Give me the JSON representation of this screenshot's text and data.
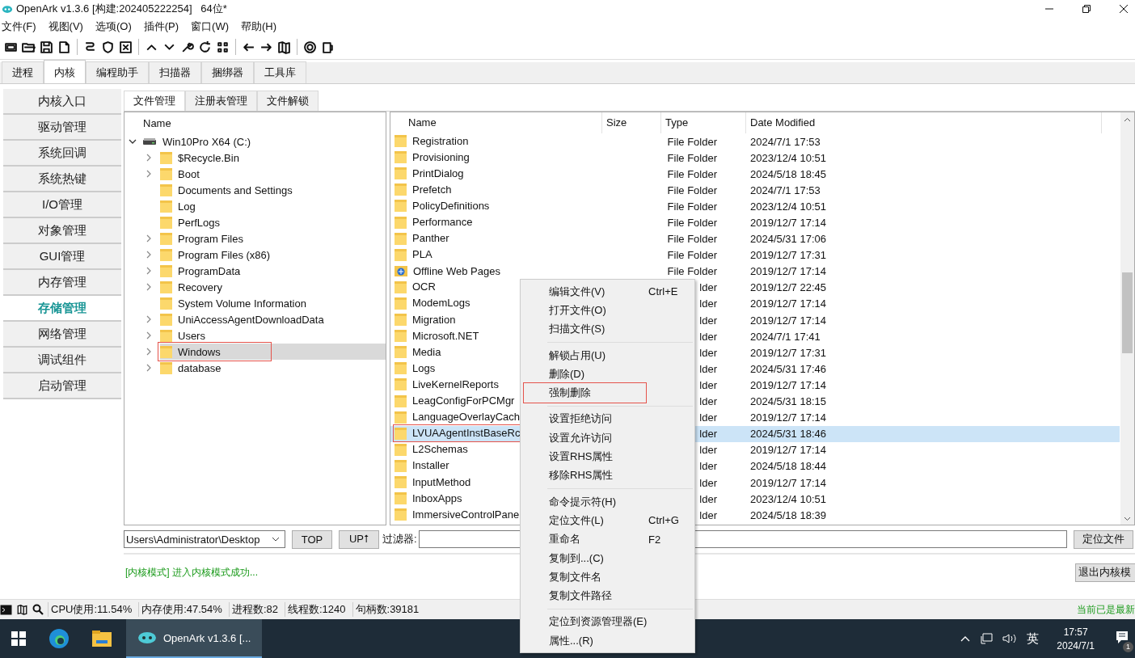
{
  "window": {
    "title": "OpenArk v1.3.6 [构建:202405222254]   64位*"
  },
  "menu": [
    "文件(F)",
    "视图(V)",
    "选项(O)",
    "插件(P)",
    "窗口(W)",
    "帮助(H)"
  ],
  "tabs": [
    {
      "label": "进程",
      "selected": false
    },
    {
      "label": "内核",
      "selected": true
    },
    {
      "label": "编程助手",
      "selected": false
    },
    {
      "label": "扫描器",
      "selected": false
    },
    {
      "label": "捆绑器",
      "selected": false
    },
    {
      "label": "工具库",
      "selected": false
    }
  ],
  "nav": [
    {
      "label": "内核入口",
      "selected": false
    },
    {
      "label": "驱动管理",
      "selected": false
    },
    {
      "label": "系统回调",
      "selected": false
    },
    {
      "label": "系统热键",
      "selected": false
    },
    {
      "label": "I/O管理",
      "selected": false
    },
    {
      "label": "对象管理",
      "selected": false
    },
    {
      "label": "GUI管理",
      "selected": false
    },
    {
      "label": "内存管理",
      "selected": false
    },
    {
      "label": "存储管理",
      "selected": true
    },
    {
      "label": "网络管理",
      "selected": false
    },
    {
      "label": "调试组件",
      "selected": false
    },
    {
      "label": "启动管理",
      "selected": false
    }
  ],
  "subtabs": [
    {
      "label": "文件管理",
      "selected": true
    },
    {
      "label": "注册表管理",
      "selected": false
    },
    {
      "label": "文件解锁",
      "selected": false
    }
  ],
  "tree": {
    "column": "Name",
    "root": {
      "label": "Win10Pro X64 (C:)",
      "expanded": true,
      "children": [
        {
          "label": "$Recycle.Bin",
          "expandable": true,
          "selected": false,
          "highlighted": false
        },
        {
          "label": "Boot",
          "expandable": true,
          "selected": false,
          "highlighted": false
        },
        {
          "label": "Documents and Settings",
          "expandable": false,
          "selected": false,
          "highlighted": false
        },
        {
          "label": "Log",
          "expandable": false,
          "selected": false,
          "highlighted": false
        },
        {
          "label": "PerfLogs",
          "expandable": false,
          "selected": false,
          "highlighted": false
        },
        {
          "label": "Program Files",
          "expandable": true,
          "selected": false,
          "highlighted": false
        },
        {
          "label": "Program Files (x86)",
          "expandable": true,
          "selected": false,
          "highlighted": false
        },
        {
          "label": "ProgramData",
          "expandable": true,
          "selected": false,
          "highlighted": false
        },
        {
          "label": "Recovery",
          "expandable": true,
          "selected": false,
          "highlighted": false
        },
        {
          "label": "System Volume Information",
          "expandable": false,
          "selected": false,
          "highlighted": false
        },
        {
          "label": "UniAccessAgentDownloadData",
          "expandable": true,
          "selected": false,
          "highlighted": false
        },
        {
          "label": "Users",
          "expandable": true,
          "selected": false,
          "highlighted": false
        },
        {
          "label": "Windows",
          "expandable": true,
          "selected": true,
          "highlighted": true
        },
        {
          "label": "database",
          "expandable": true,
          "selected": false,
          "highlighted": false
        }
      ]
    }
  },
  "file_list": {
    "columns": [
      "Name",
      "Size",
      "Type",
      "Date Modified"
    ],
    "rows": [
      {
        "name": "Registration",
        "kind": "folder",
        "type": "File Folder",
        "date": "2024/7/1 17:53",
        "selected": false,
        "highlighted": false
      },
      {
        "name": "Provisioning",
        "kind": "folder",
        "type": "File Folder",
        "date": "2023/12/4 10:51",
        "selected": false,
        "highlighted": false
      },
      {
        "name": "PrintDialog",
        "kind": "folder",
        "type": "File Folder",
        "date": "2024/5/18 18:45",
        "selected": false,
        "highlighted": false
      },
      {
        "name": "Prefetch",
        "kind": "folder",
        "type": "File Folder",
        "date": "2024/7/1 17:53",
        "selected": false,
        "highlighted": false
      },
      {
        "name": "PolicyDefinitions",
        "kind": "folder",
        "type": "File Folder",
        "date": "2023/12/4 10:51",
        "selected": false,
        "highlighted": false
      },
      {
        "name": "Performance",
        "kind": "folder",
        "type": "File Folder",
        "date": "2019/12/7 17:14",
        "selected": false,
        "highlighted": false
      },
      {
        "name": "Panther",
        "kind": "folder",
        "type": "File Folder",
        "date": "2024/5/31 17:06",
        "selected": false,
        "highlighted": false
      },
      {
        "name": "PLA",
        "kind": "folder",
        "type": "File Folder",
        "date": "2019/12/7 17:31",
        "selected": false,
        "highlighted": false
      },
      {
        "name": "Offline Web Pages",
        "kind": "special",
        "type": "File Folder",
        "date": "2019/12/7 17:14",
        "selected": false,
        "highlighted": false
      },
      {
        "name": "OCR",
        "kind": "folder",
        "type": "lder",
        "date": "2019/12/7 22:45",
        "selected": false,
        "highlighted": false
      },
      {
        "name": "ModemLogs",
        "kind": "folder",
        "type": "lder",
        "date": "2019/12/7 17:14",
        "selected": false,
        "highlighted": false
      },
      {
        "name": "Migration",
        "kind": "folder",
        "type": "lder",
        "date": "2019/12/7 17:14",
        "selected": false,
        "highlighted": false
      },
      {
        "name": "Microsoft.NET",
        "kind": "folder",
        "type": "lder",
        "date": "2024/7/1 17:41",
        "selected": false,
        "highlighted": false
      },
      {
        "name": "Media",
        "kind": "folder",
        "type": "lder",
        "date": "2019/12/7 17:31",
        "selected": false,
        "highlighted": false
      },
      {
        "name": "Logs",
        "kind": "folder",
        "type": "lder",
        "date": "2024/5/31 17:46",
        "selected": false,
        "highlighted": false
      },
      {
        "name": "LiveKernelReports",
        "kind": "folder",
        "type": "lder",
        "date": "2019/12/7 17:14",
        "selected": false,
        "highlighted": false
      },
      {
        "name": "LeagConfigForPCMgr",
        "kind": "folder",
        "type": "lder",
        "date": "2024/5/31 18:15",
        "selected": false,
        "highlighted": false
      },
      {
        "name": "LanguageOverlayCach",
        "kind": "folder",
        "type": "lder",
        "date": "2019/12/7 17:14",
        "selected": false,
        "highlighted": false
      },
      {
        "name": "LVUAAgentInstBaseRc",
        "kind": "folder",
        "type": "lder",
        "date": "2024/5/31 18:46",
        "selected": true,
        "highlighted": true
      },
      {
        "name": "L2Schemas",
        "kind": "folder",
        "type": "lder",
        "date": "2019/12/7 17:14",
        "selected": false,
        "highlighted": false
      },
      {
        "name": "Installer",
        "kind": "folder",
        "type": "lder",
        "date": "2024/5/18 18:44",
        "selected": false,
        "highlighted": false
      },
      {
        "name": "InputMethod",
        "kind": "folder",
        "type": "lder",
        "date": "2019/12/7 17:14",
        "selected": false,
        "highlighted": false
      },
      {
        "name": "InboxApps",
        "kind": "folder",
        "type": "lder",
        "date": "2023/12/4 10:51",
        "selected": false,
        "highlighted": false
      },
      {
        "name": "ImmersiveControlPane",
        "kind": "folder",
        "type": "lder",
        "date": "2024/5/18 18:39",
        "selected": false,
        "highlighted": false
      }
    ]
  },
  "path_field": {
    "value": "Users\\Administrator\\Desktop"
  },
  "nav_buttons": [
    "TOP",
    "UP⭡"
  ],
  "filter": {
    "label": "过滤器:"
  },
  "locate_button": "定位文件",
  "log": "[内核模式] 进入内核模式成功...",
  "exit_button": "退出内核模",
  "status_bar": {
    "stats": [
      "CPU使用:11.54%",
      "内存使用:47.54%",
      "进程数:82",
      "线程数:1240",
      "句柄数:39181"
    ],
    "update_note": "当前已是最新"
  },
  "context_menu": {
    "groups": [
      [
        {
          "label": "编辑文件(V)",
          "shortcut": "Ctrl+E",
          "highlighted": false
        },
        {
          "label": "打开文件(O)",
          "highlighted": false
        },
        {
          "label": "扫描文件(S)",
          "highlighted": false
        }
      ],
      [
        {
          "label": "解锁占用(U)",
          "highlighted": false
        },
        {
          "label": "删除(D)",
          "highlighted": false
        },
        {
          "label": "强制删除",
          "highlighted": true
        }
      ],
      [
        {
          "label": "设置拒绝访问",
          "highlighted": false
        },
        {
          "label": "设置允许访问",
          "highlighted": false
        },
        {
          "label": "设置RHS属性",
          "highlighted": false
        },
        {
          "label": "移除RHS属性",
          "highlighted": false
        }
      ],
      [
        {
          "label": "命令提示符(H)",
          "highlighted": false
        },
        {
          "label": "定位文件(L)",
          "shortcut": "Ctrl+G",
          "highlighted": false
        },
        {
          "label": "重命名",
          "shortcut": "F2",
          "highlighted": false
        },
        {
          "label": "复制到...(C)",
          "highlighted": false
        },
        {
          "label": "复制文件名",
          "highlighted": false
        },
        {
          "label": "复制文件路径",
          "highlighted": false
        }
      ],
      [
        {
          "label": "定位到资源管理器(E)",
          "highlighted": false
        },
        {
          "label": "属性...(R)",
          "highlighted": false
        }
      ]
    ]
  },
  "taskbar": {
    "app": "OpenArk v1.3.6 [...",
    "ime": "英",
    "time": "17:57",
    "date": "2024/7/1",
    "badge": "1"
  }
}
